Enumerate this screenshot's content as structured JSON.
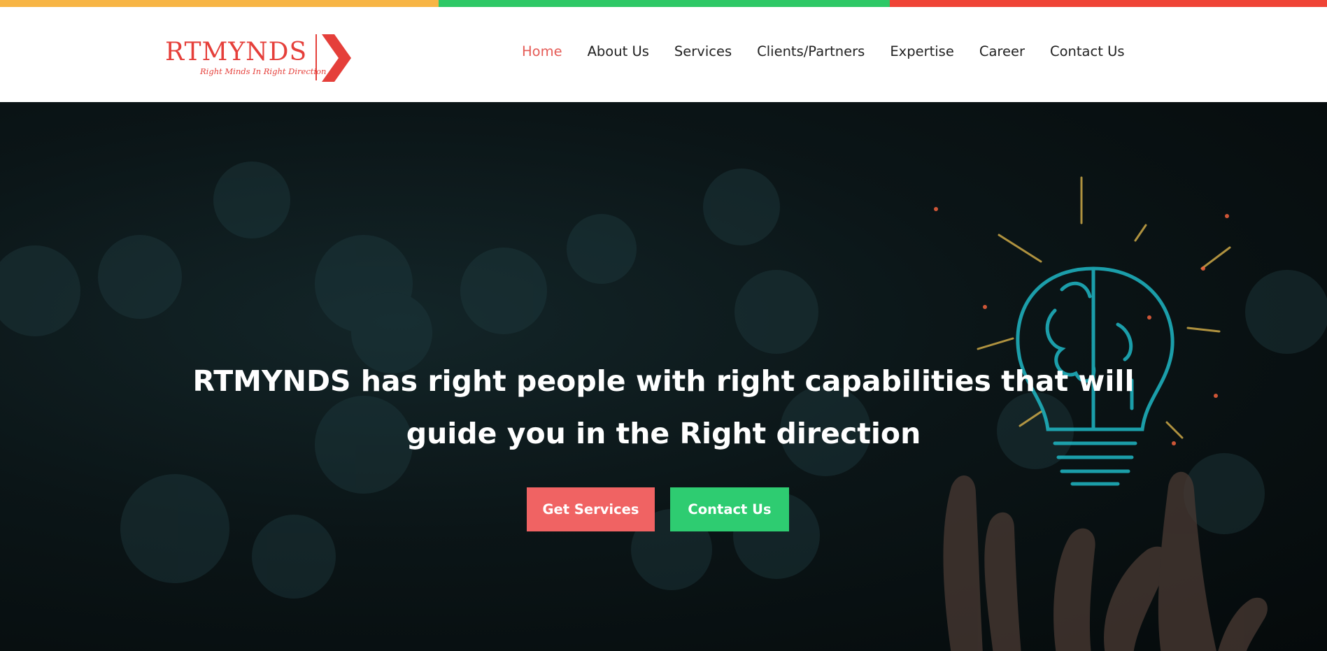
{
  "colors": {
    "stripe_orange": "#f7b545",
    "stripe_green": "#2ec866",
    "stripe_red": "#ef4436",
    "brand_red": "#e53f3a",
    "nav_text": "#222222",
    "nav_active": "#e55b56",
    "button_red": "#f06363",
    "button_green": "#2ecc71",
    "hero_text": "#ffffff",
    "neon": "#1fb7c4",
    "spark": "#d9b24a"
  },
  "logo": {
    "name": "RTMYNDS",
    "tagline": "Right Minds In Right Direction"
  },
  "nav": {
    "items": [
      {
        "label": "Home",
        "active": true
      },
      {
        "label": "About Us",
        "active": false
      },
      {
        "label": "Services",
        "active": false
      },
      {
        "label": "Clients/Partners",
        "active": false
      },
      {
        "label": "Expertise",
        "active": false
      },
      {
        "label": "Career",
        "active": false
      },
      {
        "label": "Contact Us",
        "active": false
      }
    ]
  },
  "hero": {
    "headline": "RTMYNDS has right people with right capabilities that will guide you in the Right direction",
    "buttons": {
      "primary": "Get Services",
      "secondary": "Contact Us"
    },
    "image_icons": [
      "lightbulb-brain-icon",
      "hand-icon"
    ]
  }
}
